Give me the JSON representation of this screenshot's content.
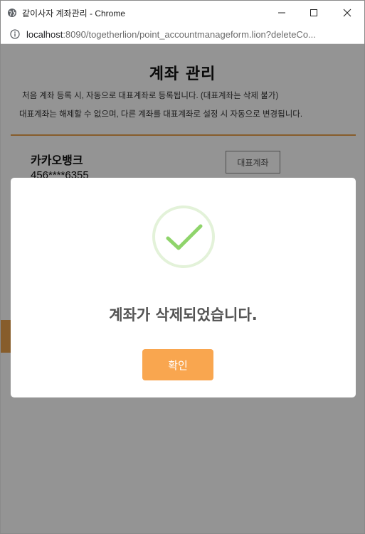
{
  "window": {
    "title": "같이사자 계좌관리 - Chrome",
    "minimize_icon": "minimize-icon",
    "maximize_icon": "maximize-icon",
    "close_icon": "close-icon"
  },
  "address": {
    "host": "localhost",
    "path": ":8090/togetherlion/point_accountmanageform.lion?deleteCo..."
  },
  "page": {
    "title": "계좌 관리",
    "note1": "처음 계좌 등록 시, 자동으로 대표계좌로 등록됩니다. (대표계좌는 삭제 불가)",
    "note2": "대표계좌는 해제할 수 없으며, 다른 계좌를 대표계좌로 설정 시 자동으로 변경됩니다."
  },
  "account": {
    "bank": "카카오뱅크",
    "number": "456****6355",
    "rep_button": "대표계좌"
  },
  "modal": {
    "message": "계좌가 삭제되었습니다.",
    "confirm": "확인"
  },
  "colors": {
    "accent": "#f9a64f",
    "divider": "#e8a04a",
    "success": "#8fd46b"
  }
}
